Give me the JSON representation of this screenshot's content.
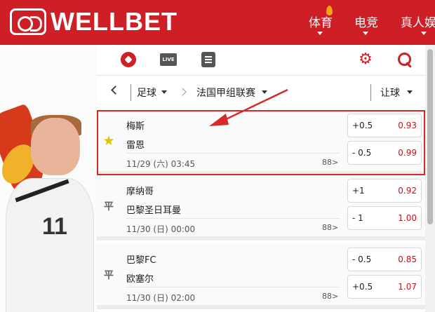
{
  "brand": {
    "name": "WELLBET",
    "color": "#cf1f26"
  },
  "nav": {
    "items": [
      {
        "label": "体育"
      },
      {
        "label": "电竞"
      },
      {
        "label": "真人娱"
      }
    ]
  },
  "toolbar": {
    "live_label": "LIVE",
    "icons": [
      "soccer-ball-icon",
      "live-icon",
      "list-icon",
      "gear-icon",
      "search-icon"
    ]
  },
  "filters": {
    "sport": "足球",
    "league": "法国甲组联赛",
    "market": "让球"
  },
  "promo": {
    "shirt_number": "11"
  },
  "matches": [
    {
      "home": "梅斯",
      "away": "雷恩",
      "date": "11/29 (六) 03:45",
      "more": "88>",
      "favorite": true,
      "odds": [
        {
          "handicap": "+0.5",
          "value": "0.93"
        },
        {
          "handicap": "- 0.5",
          "value": "0.99"
        }
      ]
    },
    {
      "home": "摩纳哥",
      "away": "巴黎圣日耳曼",
      "date": "11/30 (日) 00:00",
      "more": "88>",
      "favorite": false,
      "mark": "平",
      "odds": [
        {
          "handicap": "+1",
          "value": "0.92"
        },
        {
          "handicap": "- 1",
          "value": "1.00"
        }
      ]
    },
    {
      "home": "巴黎FC",
      "away": "欧塞尔",
      "date": "11/30 (日) 02:00",
      "more": "88>",
      "favorite": false,
      "mark": "平",
      "odds": [
        {
          "handicap": "- 0.5",
          "value": "0.85"
        },
        {
          "handicap": "+0.5",
          "value": "1.07"
        }
      ]
    }
  ]
}
